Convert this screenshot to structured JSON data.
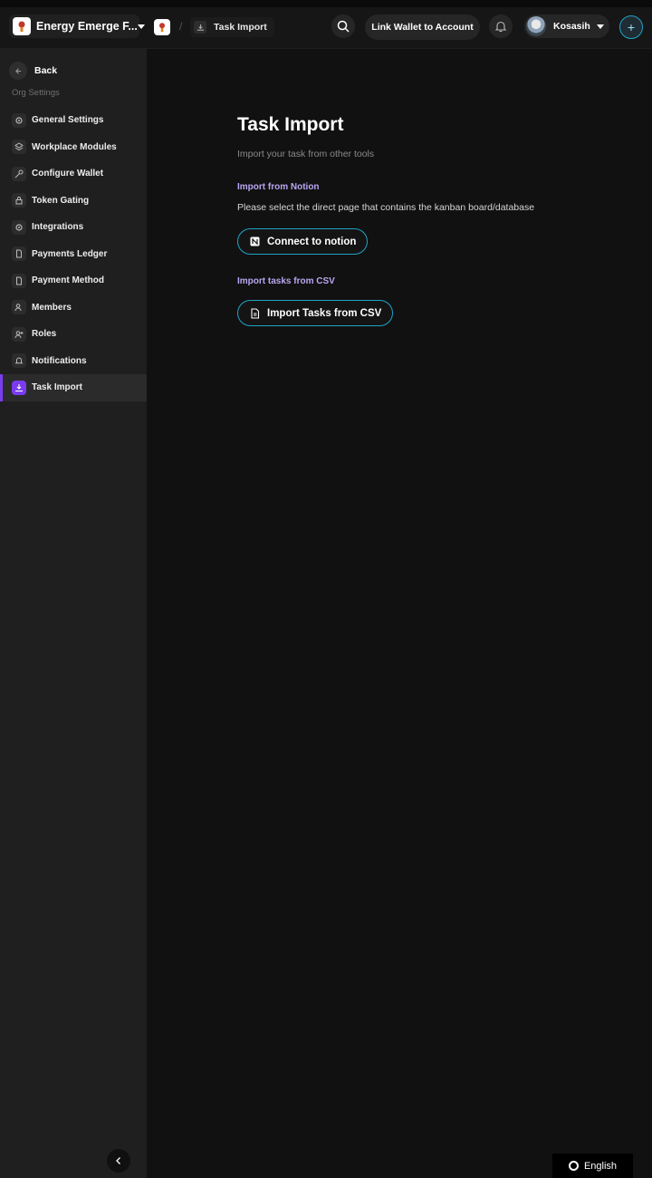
{
  "header": {
    "org_name": "Energy Emerge F...",
    "breadcrumb_current": "Task Import",
    "breadcrumb_separator": "/",
    "link_wallet_label": "Link Wallet to Account",
    "user_name": "Kosasih",
    "icons": [
      "search-icon",
      "bell-icon",
      "plus-icon",
      "chevron-down-icon"
    ]
  },
  "sidebar": {
    "back_label": "Back",
    "section_title": "Org Settings",
    "items": [
      {
        "label": "General Settings",
        "icon": "gear-icon"
      },
      {
        "label": "Workplace Modules",
        "icon": "layers-icon"
      },
      {
        "label": "Configure Wallet",
        "icon": "key-icon"
      },
      {
        "label": "Token Gating",
        "icon": "lock-icon"
      },
      {
        "label": "Integrations",
        "icon": "gear-icon"
      },
      {
        "label": "Payments Ledger",
        "icon": "document-icon"
      },
      {
        "label": "Payment Method",
        "icon": "document-icon"
      },
      {
        "label": "Members",
        "icon": "users-icon"
      },
      {
        "label": "Roles",
        "icon": "user-plus-icon"
      },
      {
        "label": "Notifications",
        "icon": "bell-icon"
      },
      {
        "label": "Task Import",
        "icon": "import-icon",
        "active": true
      }
    ]
  },
  "main": {
    "title": "Task Import",
    "subtitle": "Import your task from other tools",
    "notion_heading": "Import from Notion",
    "notion_description": "Please select the direct page that contains the kanban board/database",
    "notion_button": "Connect to notion",
    "csv_heading": "Import tasks from CSV",
    "csv_button": "Import Tasks from CSV"
  },
  "footer": {
    "language": "English"
  },
  "colors": {
    "accent_purple": "#7a3cf0",
    "accent_cyan": "#1fa3c6",
    "heading_lilac": "#b9a6f2"
  }
}
